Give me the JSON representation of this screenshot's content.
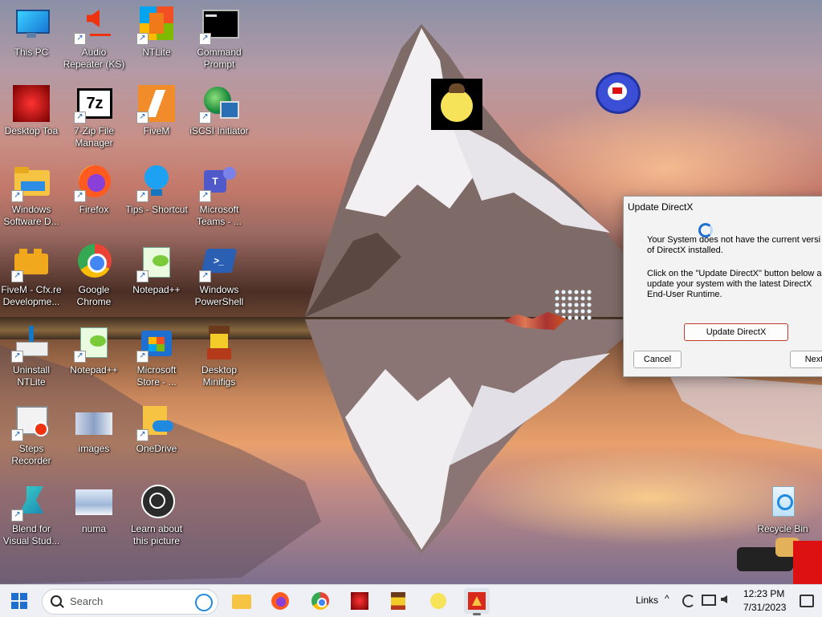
{
  "desktop": {
    "icons": [
      {
        "label": "This PC"
      },
      {
        "label": "Audio Repeater (KS)"
      },
      {
        "label": "NTLite"
      },
      {
        "label": "Command Prompt"
      },
      {
        "label": "Desktop Toa"
      },
      {
        "label": "7-Zip File Manager"
      },
      {
        "label": "FiveM"
      },
      {
        "label": "iSCSI Initiator"
      },
      {
        "label": "Windows Software D..."
      },
      {
        "label": "Firefox"
      },
      {
        "label": "Tips - Shortcut"
      },
      {
        "label": "Microsoft Teams - ..."
      },
      {
        "label": "FiveM - Cfx.re Developme..."
      },
      {
        "label": "Google Chrome"
      },
      {
        "label": "Notepad++"
      },
      {
        "label": "Windows PowerShell"
      },
      {
        "label": "Uninstall NTLite"
      },
      {
        "label": "Notepad++"
      },
      {
        "label": "Microsoft Store - ..."
      },
      {
        "label": "Desktop Minifigs"
      },
      {
        "label": "Steps Recorder"
      },
      {
        "label": "images"
      },
      {
        "label": "OneDrive"
      },
      {
        "label": "Blend for Visual Stud..."
      },
      {
        "label": "numa"
      },
      {
        "label": "Learn about this picture"
      },
      {
        "label": "Recycle Bin"
      }
    ]
  },
  "dialog": {
    "title": "Update DirectX",
    "message1": "Your System does not have the current versi\nof DirectX installed.",
    "message2": "Click on the \"Update DirectX\" button below an\nupdate your system with the latest DirectX\nEnd-User Runtime.",
    "update_button": "Update DirectX",
    "cancel_button": "Cancel",
    "next_button": "Next"
  },
  "taskbar": {
    "search_placeholder": "Search",
    "links_label": "Links",
    "time": "12:23 PM",
    "date": "7/31/2023"
  },
  "colors": {
    "taskbar_bg": "#eef0f5",
    "dialog_bg": "#f3f3f3",
    "primary_button_border": "#c0392b"
  }
}
